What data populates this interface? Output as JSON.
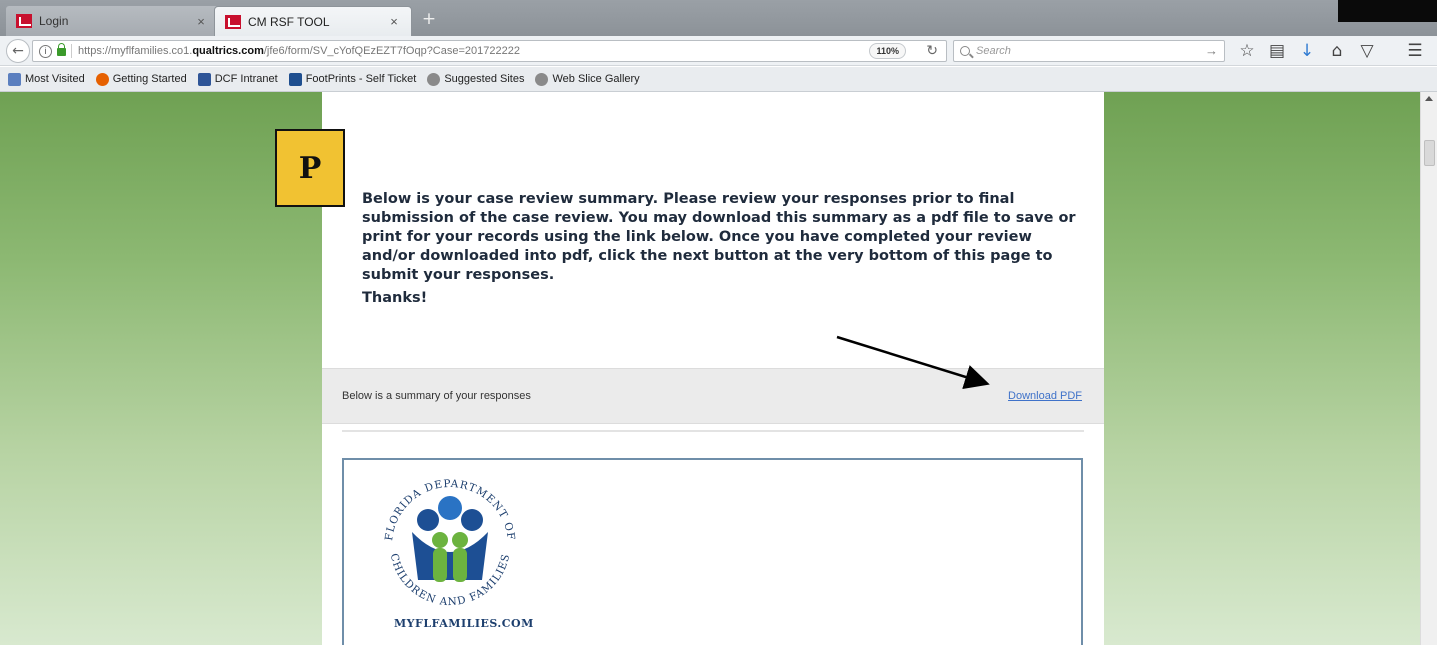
{
  "browser": {
    "tabs": [
      {
        "label": "Login"
      },
      {
        "label": "CM RSF TOOL"
      }
    ],
    "tab_close_glyph": "×",
    "new_tab_glyph": "+",
    "url_prefix": "https://myflfamilies.co1.",
    "url_domain": "qualtrics.com",
    "url_path": "/jfe6/form/SV_cYofQEzEZT7fOqp?Case=201722222",
    "zoom": "110%",
    "search_placeholder": "Search",
    "icons": [
      "back-icon",
      "info-icon",
      "lock-icon",
      "reload-icon",
      "search-icon",
      "arrow-right-icon",
      "star-icon",
      "reading-list-icon",
      "download-icon",
      "home-icon",
      "pocket-icon",
      "menu-icon"
    ]
  },
  "bookmarks": [
    {
      "label": "Most Visited",
      "icon": "folder-icon",
      "color": "#5b7fbf"
    },
    {
      "label": "Getting Started",
      "icon": "firefox-icon",
      "color": "#e66000"
    },
    {
      "label": "DCF Intranet",
      "icon": "dcf-icon",
      "color": "#2f5597"
    },
    {
      "label": "FootPrints - Self Ticket",
      "icon": "footprints-icon",
      "color": "#1f4f8f"
    },
    {
      "label": "Suggested Sites",
      "icon": "globe-icon",
      "color": "#7a7a7a"
    },
    {
      "label": "Web Slice Gallery",
      "icon": "globe-icon",
      "color": "#7a7a7a"
    }
  ],
  "page": {
    "intro": "Below is your case review summary. Please review your responses prior to final submission of the case review. You may download this summary as a pdf file to save or print for your records using the link below. Once you have completed your review and/or downloaded into pdf, click the next button at the very bottom of this page to submit your responses.",
    "thanks": "Thanks!",
    "summary_label": "Below is a summary of your responses",
    "download_link": "Download PDF",
    "logo_ring_top": "FLORIDA DEPARTMENT OF",
    "logo_ring_bottom": "CHILDREN AND FAMILIES",
    "logo_caption": "MYFLFAMILIES.COM"
  },
  "annotation": {
    "badge_letter": "P",
    "badge_color": "#f1c232"
  },
  "colors": {
    "background_green": "#6fa153",
    "link": "#3f72c9",
    "heading_text": "#1f2b3c"
  }
}
